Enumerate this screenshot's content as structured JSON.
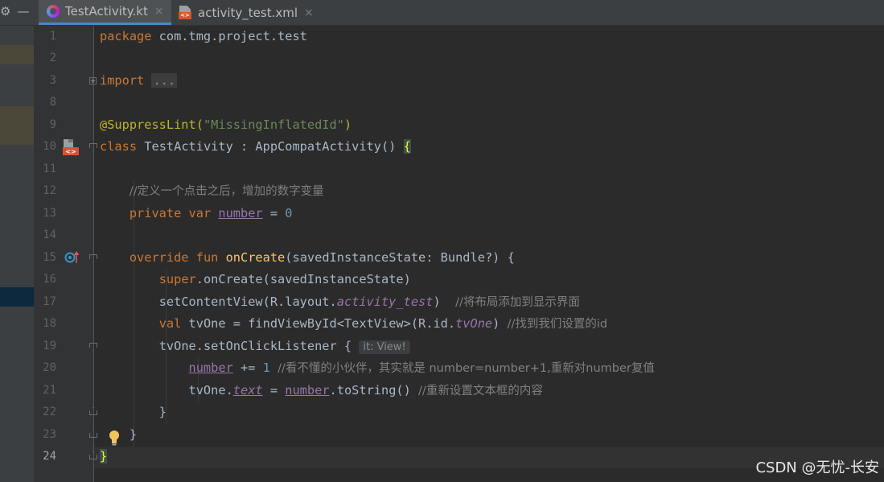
{
  "tabs": [
    {
      "label": "TestActivity.kt",
      "icon": "kotlin-file-icon",
      "active": true
    },
    {
      "label": "activity_test.xml",
      "icon": "xml-file-icon",
      "active": false
    }
  ],
  "tab_close_glyph": "×",
  "window_controls": {
    "settings": "⚙",
    "minimize": "—"
  },
  "line_numbers": [
    "1",
    "2",
    "3",
    "8",
    "9",
    "10",
    "11",
    "12",
    "13",
    "14",
    "15",
    "16",
    "17",
    "18",
    "19",
    "20",
    "21",
    "22",
    "23",
    "24"
  ],
  "code": {
    "l1": {
      "kw": "package",
      "rest": " com.tmg.project.test"
    },
    "l3": {
      "kw": "import",
      "fold": "..."
    },
    "l9": {
      "ann": "@SuppressLint(",
      "str": "\"MissingInflatedId\"",
      "close": ")"
    },
    "l10": {
      "kw": "class",
      "name": " TestActivity : AppCompatActivity() ",
      "brace": "{"
    },
    "l12": {
      "comment": "//定义一个点击之后，增加的数字变量"
    },
    "l13": {
      "kw1": "private",
      "kw2": " var ",
      "prop": "number",
      "eq": " = ",
      "num": "0"
    },
    "l15": {
      "kw1": "override",
      "kw2": " fun ",
      "fn": "onCreate",
      "rest": "(savedInstanceState: Bundle?) {"
    },
    "l16": {
      "kw": "super",
      "rest": ".onCreate(savedInstanceState)"
    },
    "l17": {
      "a": "setContentView(R.layout.",
      "ital": "activity_test",
      "b": ")  ",
      "comment": "//将布局添加到显示界面"
    },
    "l18": {
      "kw": "val",
      "a": " tvOne = findViewById<TextView>(R.id.",
      "ital": "tvOne",
      "b": ") ",
      "comment": "//找到我们设置的id"
    },
    "l19": {
      "a": "tvOne.setOnClickListener { ",
      "hint": "it: View!"
    },
    "l20": {
      "prop": "number",
      "a": " += ",
      "num": "1",
      "b": " ",
      "comment": "//看不懂的小伙伴，其实就是 number=number+1,重新对number复值"
    },
    "l21": {
      "a": "tvOne.",
      "ital": "text",
      "b": " = ",
      "prop": "number",
      "c": ".toString() ",
      "comment": "//重新设置文本框的内容"
    },
    "l22": {
      "a": "}"
    },
    "l23": {
      "a": "}"
    },
    "l24": {
      "brace": "}"
    }
  },
  "watermark": "CSDN @无忧-长安",
  "colors": {
    "background": "#2b2b2b",
    "keyword": "#cc7832",
    "string": "#6a8759",
    "comment": "#808080",
    "function": "#ffc66d",
    "number": "#6897bb",
    "property": "#9876aa"
  }
}
